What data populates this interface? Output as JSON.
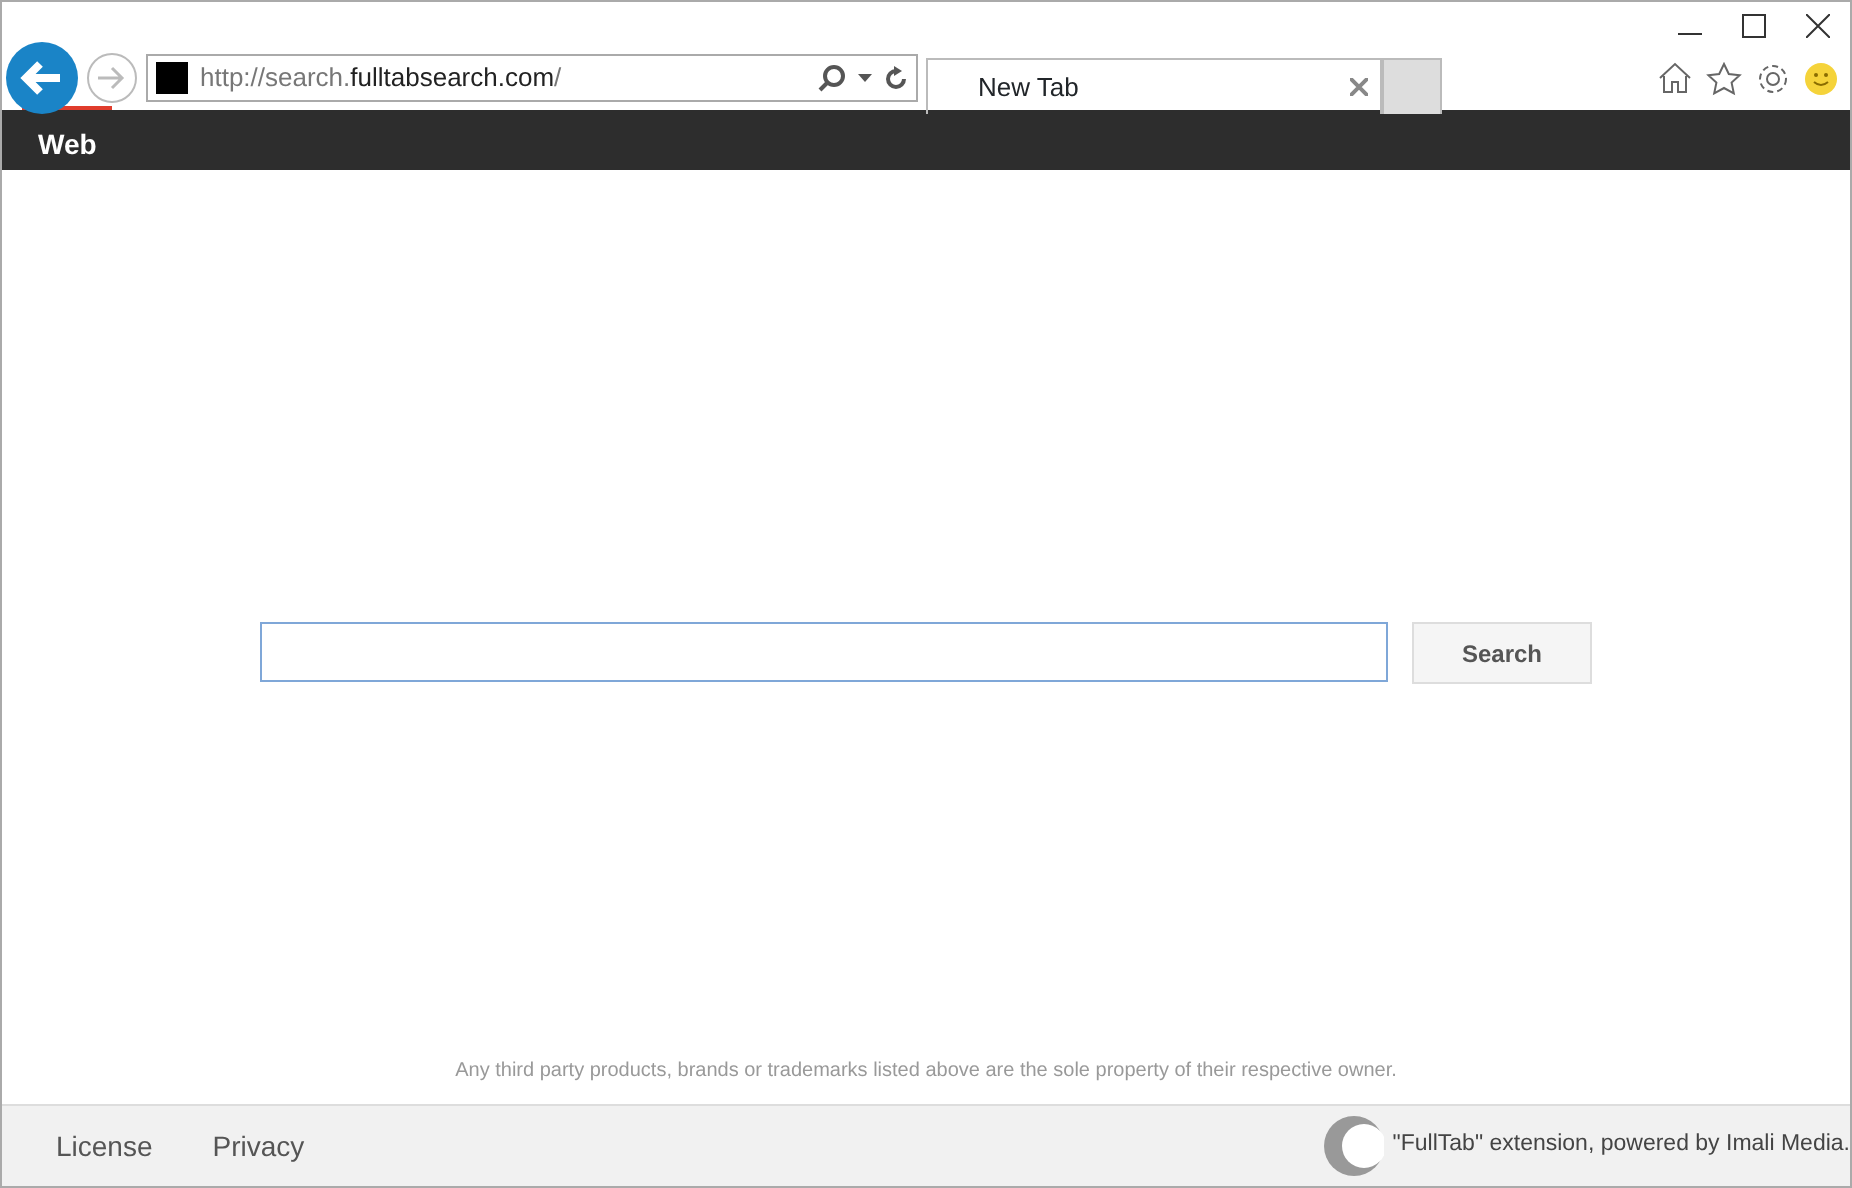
{
  "address_bar": {
    "parts": [
      {
        "text": "http://search.",
        "emphasis": false
      },
      {
        "text": "fulltabsearch.com",
        "emphasis": true
      },
      {
        "text": "/",
        "emphasis": false
      }
    ]
  },
  "tabs": [
    {
      "label": "New Tab",
      "selected": true
    }
  ],
  "nav": {
    "items": [
      {
        "label": "Web",
        "selected": true
      }
    ]
  },
  "search": {
    "button": "Search"
  },
  "disclaimer": "Any third party products, brands or trademarks listed above are the sole property of their respective owner.",
  "footer": {
    "links": [
      "License",
      "Privacy"
    ],
    "credit": "\"FullTab\" extension, powered by Imali Media."
  }
}
